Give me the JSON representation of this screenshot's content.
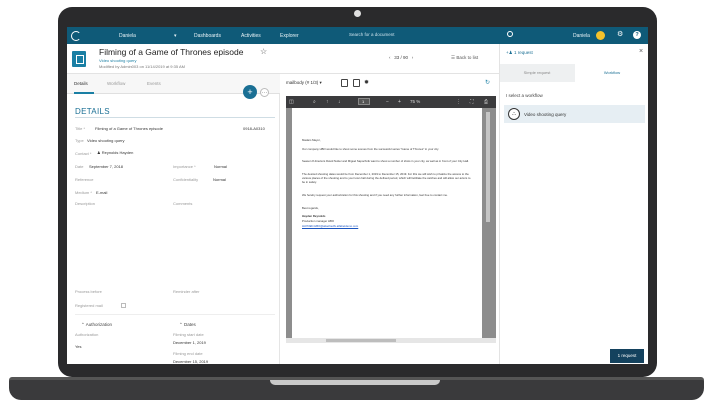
{
  "topbar": {
    "user": "Daniela",
    "nav": [
      "Dashboards",
      "Activities",
      "Explorer"
    ],
    "search_placeholder": "Search for a document",
    "right_user": "Daniela"
  },
  "document": {
    "title": "Filming of a Game of Thrones episode",
    "type": "Video shooting query",
    "modified": "Modified by Admin003 on 11/14/2019 at 9:35 AM",
    "pager": "33 / 90",
    "back_label": "Back to list"
  },
  "left": {
    "tabs": [
      "Details",
      "Workflow",
      "Events"
    ],
    "fab_label": "+",
    "more_label": "…",
    "section_title": "DETAILS",
    "fields": {
      "title_label": "Title *",
      "title_value": "Filming of a Game of Thrones episode",
      "ref_code": "0918-A0310",
      "type_label": "Type",
      "type_value": "Video shooting query",
      "contact_label": "Contact *",
      "contact_value": "Reynolds Hayden",
      "date_label": "Date",
      "date_value": "September 7, 2018",
      "importance_label": "Importance *",
      "importance_value": "Normal",
      "reference_label": "Reference",
      "confidentiality_label": "Confidentiality",
      "confidentiality_value": "Normal",
      "medium_label": "Medium *",
      "medium_value": "E-mail",
      "description_label": "Description",
      "comments_label": "Comments",
      "process_before_label": "Process before",
      "reminder_label": "Reminder after",
      "registered_mail_label": "Registered mail"
    },
    "authorization": {
      "header": "Authorization",
      "label": "Authorization",
      "value": "Yes"
    },
    "dates": {
      "header": "Dates",
      "start_label": "Filming start date",
      "start_value": "December 1, 2019",
      "end_label": "Filming end date",
      "end_value": "December 15, 2019"
    }
  },
  "viewer": {
    "select_value": "mailbody (# 1/3)",
    "zoom": "75 %",
    "page_number": "1",
    "letter": [
      "Madam Mayor,",
      "Our company HBO would like to shoot some scenes from the successful series \"Game of Thrones\" in your city.",
      "Season 8 directors David Nutter and Miguel Sapochnik want to shoot a number of shots in your city, as well as in front of your City Hall.",
      "The desired shooting dates would be from December 1, 2019 to December 15, 2019. For this we will wish to privatize the access to the various places of the shooting and to your town hall during the defined period, which will facilitate the catches and will allow our actors to be in safety.",
      "We hereby request your authorization for this shooting and if you need any further information, feel free to contact me.",
      "Best regards,",
      "Hayden Reynolds",
      "Production manager HBO",
      "HAYDEN.HBO@attachedfx.alfabetdemo.com"
    ]
  },
  "right_panel": {
    "request_count": "1 request",
    "tabs": [
      "Simple request",
      "Workflow"
    ],
    "select_prompt": "I select a workflow",
    "workflow_item": "Video shooting query",
    "button": "1 request"
  },
  "colors": {
    "brand": "#0f5a78",
    "accent": "#1a7fa4",
    "button_dark": "#14425e"
  }
}
